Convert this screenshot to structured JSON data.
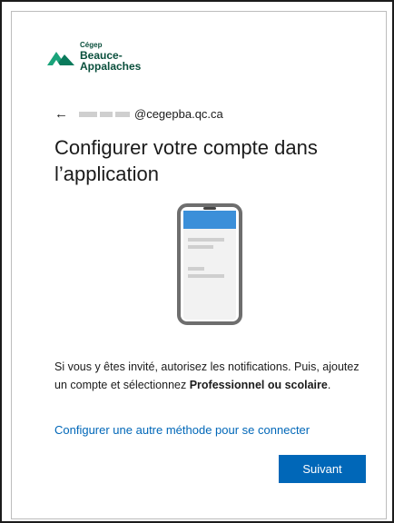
{
  "brand": {
    "small": "Cégep",
    "line1": "Beauce-",
    "line2": "Appalaches",
    "color": "#0a4f3c",
    "accent": "#1aa37a"
  },
  "account": {
    "email_suffix": "@cegepba.qc.ca",
    "back_icon": "arrow-left-icon"
  },
  "page": {
    "title": "Configurer votre compte dans l’application"
  },
  "instructions": {
    "part1": "Si vous y êtes invité, autorisez les notifications. Puis, ajoutez un compte et sélectionnez ",
    "bold": "Professionnel ou scolaire",
    "part2": "."
  },
  "links": {
    "alternate_method": "Configurer une autre méthode pour se connecter"
  },
  "buttons": {
    "next": "Suivant"
  },
  "colors": {
    "primary": "#0067b8",
    "phone_screen_header": "#3b8fd9",
    "phone_body": "#6e6e6e"
  }
}
